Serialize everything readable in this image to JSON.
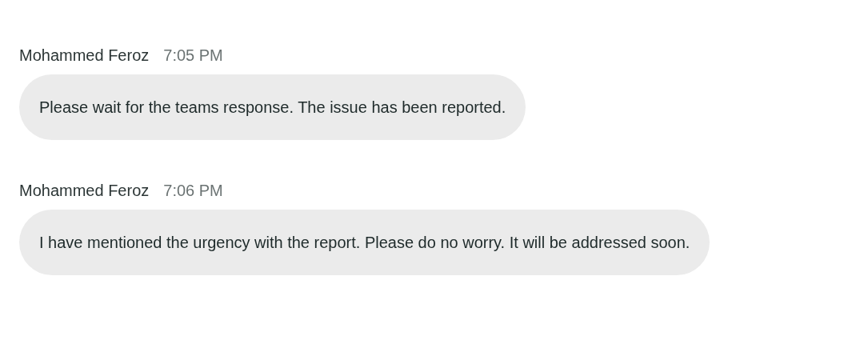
{
  "messages": [
    {
      "sender": "Mohammed Feroz",
      "time": "7:05 PM",
      "text": "Please wait for the teams response. The issue has been reported."
    },
    {
      "sender": "Mohammed Feroz",
      "time": "7:06 PM",
      "text": "I have mentioned the urgency with the report. Please do no worry. It will be addressed soon."
    }
  ]
}
